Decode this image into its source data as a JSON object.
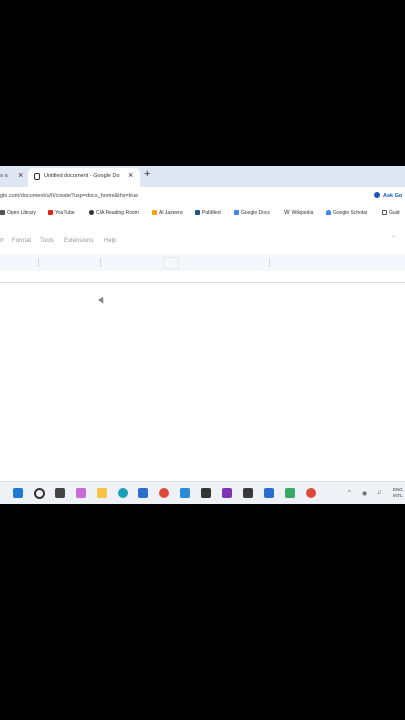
{
  "browser": {
    "prev_tab_label": "o a",
    "active_tab_title": "Untitled document - Google Do",
    "url": "gle.com/document/u/0/create?usp=docs_home&ths=true",
    "ask_label": "Ask Go"
  },
  "bookmarks": [
    {
      "label": "Open Library",
      "color": "#555555"
    },
    {
      "label": "YouTube",
      "color": "#e62117"
    },
    {
      "label": "CIA Reading Room",
      "color": "#333333"
    },
    {
      "label": "Al Jazeera",
      "color": "#f2a600"
    },
    {
      "label": "PubMed",
      "color": "#20558a"
    },
    {
      "label": "Google Docs",
      "color": "#4285f4"
    },
    {
      "label": "Wikipedia",
      "color": "#333333"
    },
    {
      "label": "Google Scholar",
      "color": "#4285f4"
    },
    {
      "label": "Guid",
      "color": "#555555"
    }
  ],
  "docs": {
    "menu": [
      "rt",
      "Format",
      "Tools",
      "Extensions",
      "Help"
    ]
  },
  "taskbar": {
    "icons": [
      {
        "name": "windows-start-icon",
        "color": "#1e78d6"
      },
      {
        "name": "search-icon",
        "color": "#333333"
      },
      {
        "name": "task-view-icon",
        "color": "#444444"
      },
      {
        "name": "copilot-icon",
        "color": "#c86bd8"
      },
      {
        "name": "file-explorer-icon",
        "color": "#f6c343"
      },
      {
        "name": "edge-icon",
        "color": "#1aa0b8"
      },
      {
        "name": "store-icon",
        "color": "#2a6ed0"
      },
      {
        "name": "chrome-icon",
        "color": "#de4a3a"
      },
      {
        "name": "photos-icon",
        "color": "#2a8ad8"
      },
      {
        "name": "terminal-icon",
        "color": "#333333"
      },
      {
        "name": "onenote-icon",
        "color": "#7b36b5"
      },
      {
        "name": "sticky-notes-icon",
        "color": "#3a3a3a"
      },
      {
        "name": "mail-icon",
        "color": "#2a6ed0"
      },
      {
        "name": "chat-icon",
        "color": "#38a865"
      },
      {
        "name": "chrome-profile-icon",
        "color": "#de4a3a"
      }
    ],
    "lang_line1": "ENG",
    "lang_line2": "INTL"
  }
}
